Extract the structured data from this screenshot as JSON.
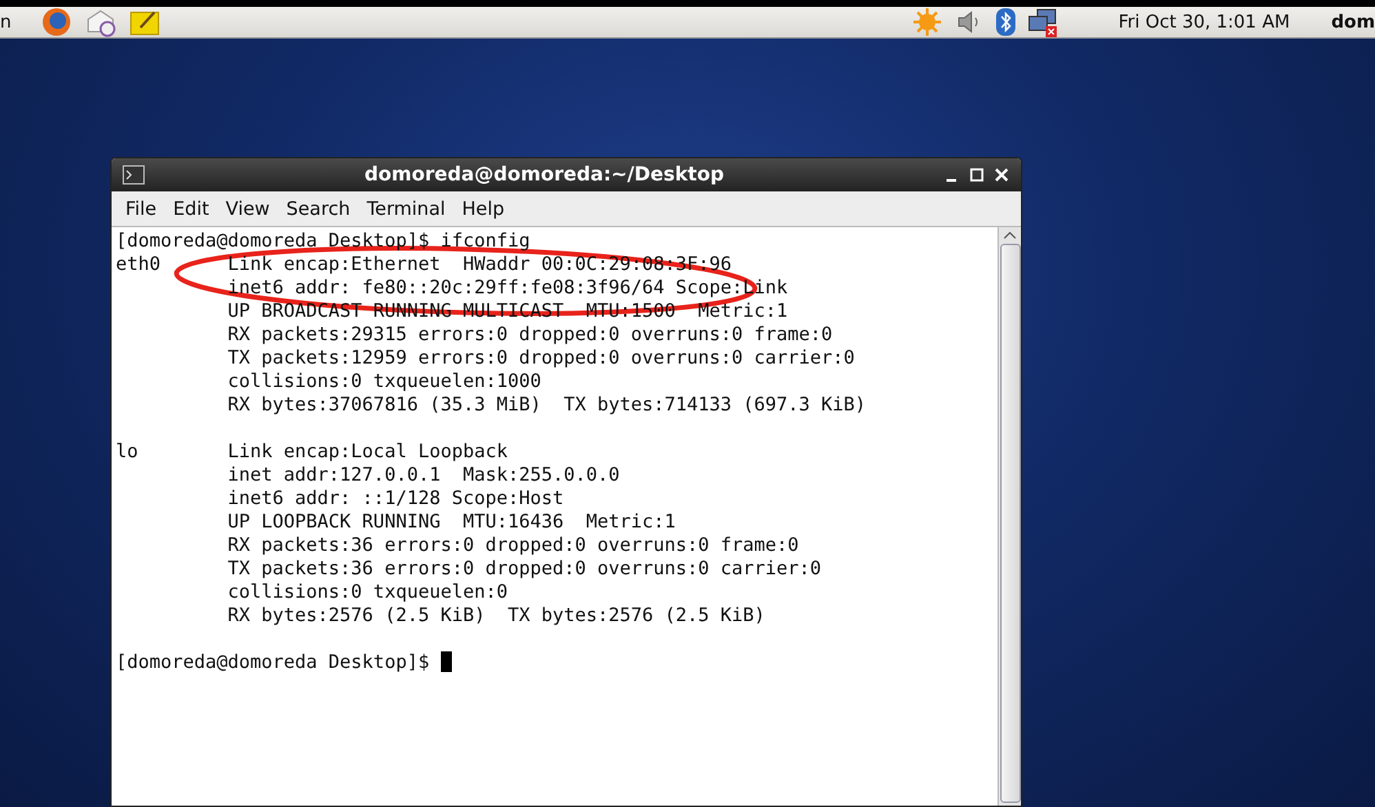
{
  "top_panel": {
    "left_text": "n",
    "clock": "Fri Oct 30,  1:01 AM",
    "user": "dom"
  },
  "window": {
    "title": "domoreda@domoreda:~/Desktop"
  },
  "menu": [
    "File",
    "Edit",
    "View",
    "Search",
    "Terminal",
    "Help"
  ],
  "terminal": {
    "blocks": [
      [
        "[domoreda@domoreda Desktop]$ ifconfig",
        "eth0      Link encap:Ethernet  HWaddr 00:0C:29:08:3F:96",
        "          inet6 addr: fe80::20c:29ff:fe08:3f96/64 Scope:Link",
        "          UP BROADCAST RUNNING MULTICAST  MTU:1500  Metric:1",
        "          RX packets:29315 errors:0 dropped:0 overruns:0 frame:0",
        "          TX packets:12959 errors:0 dropped:0 overruns:0 carrier:0",
        "          collisions:0 txqueuelen:1000",
        "          RX bytes:37067816 (35.3 MiB)  TX bytes:714133 (697.3 KiB)"
      ],
      [
        "lo        Link encap:Local Loopback",
        "          inet addr:127.0.0.1  Mask:255.0.0.0",
        "          inet6 addr: ::1/128 Scope:Host",
        "          UP LOOPBACK RUNNING  MTU:16436  Metric:1",
        "          RX packets:36 errors:0 dropped:0 overruns:0 frame:0",
        "          TX packets:36 errors:0 dropped:0 overruns:0 carrier:0",
        "          collisions:0 txqueuelen:0",
        "          RX bytes:2576 (2.5 KiB)  TX bytes:2576 (2.5 KiB)"
      ]
    ],
    "prompt": "[domoreda@domoreda Desktop]$ "
  }
}
